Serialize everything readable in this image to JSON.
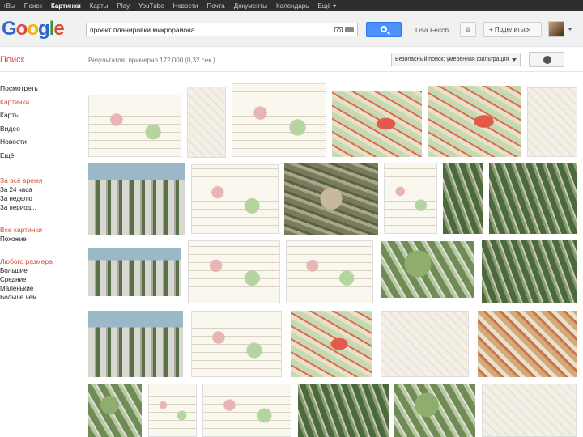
{
  "topbar": {
    "items": [
      "+Вы",
      "Поиск",
      "Картинки",
      "Карты",
      "Play",
      "YouTube",
      "Новости",
      "Почта",
      "Документы",
      "Календарь",
      "Ещё ▾"
    ],
    "active_index": 2
  },
  "logo": {
    "letters": [
      "G",
      "o",
      "o",
      "g",
      "l",
      "e"
    ],
    "colors": [
      "#3366cc",
      "#dd4b39",
      "#eeb211",
      "#3366cc",
      "#339933",
      "#dd4b39"
    ]
  },
  "search": {
    "query": "проект планировки микрорайона"
  },
  "user": {
    "name": "Lisa Feitch",
    "share_label": "+ Поделиться"
  },
  "subbar": {
    "section_title": "Поиск",
    "results_text": "Результатов: примерно 172 000 (0,32 сек.)",
    "safe_search_label": "Безопасный поиск: умеренная фильтрация"
  },
  "leftnav": {
    "items": [
      "Посмотреть",
      "Картинки",
      "Карты",
      "Видео",
      "Новости",
      "Ещё"
    ],
    "active_index": 1,
    "time_title": "За всё время",
    "time_options": [
      "За 24 часа",
      "За неделю",
      "За период..."
    ],
    "images_title": "Все картинки",
    "images_options": [
      "Похожие"
    ],
    "size_title": "Любого размера",
    "size_options": [
      "Большие",
      "Средние",
      "Маленькие",
      "Больше чем..."
    ]
  },
  "accent": "#dd4b39",
  "search_button_color": "#4d90fe"
}
